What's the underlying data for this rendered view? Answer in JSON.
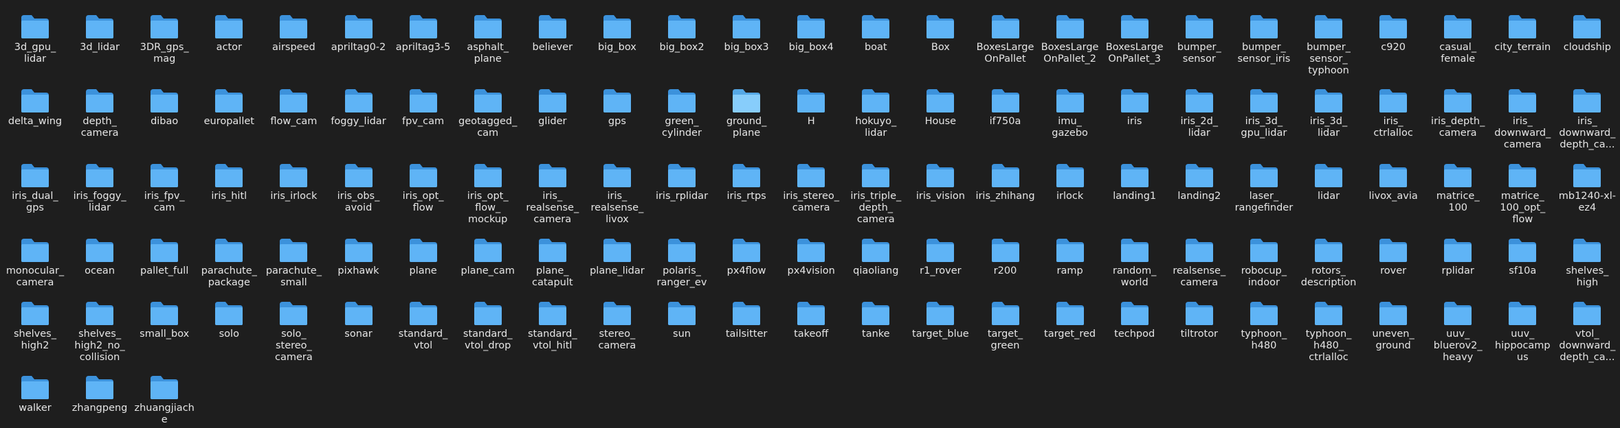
{
  "window": {
    "title": ""
  },
  "colors": {
    "background": "#1e1e1e",
    "folder_back": "#3c92dc",
    "folder_front": "#5fb4f6",
    "folder_back_selected": "#55a8e6",
    "folder_front_selected": "#87cdfb",
    "label": "#e6e6e6"
  },
  "icon_name": "folder-icon",
  "rows": [
    [
      {
        "label": "3d_gpu_\nlidar",
        "name": "3d_gpu_lidar"
      },
      {
        "label": "3d_lidar",
        "name": "3d_lidar"
      },
      {
        "label": "3DR_gps_\nmag",
        "name": "3DR_gps_mag"
      },
      {
        "label": "actor",
        "name": "actor"
      },
      {
        "label": "airspeed",
        "name": "airspeed"
      },
      {
        "label": "apriltag0-2",
        "name": "apriltag0-2"
      },
      {
        "label": "apriltag3-5",
        "name": "apriltag3-5"
      },
      {
        "label": "asphalt_\nplane",
        "name": "asphalt_plane"
      },
      {
        "label": "believer",
        "name": "believer"
      },
      {
        "label": "big_box",
        "name": "big_box"
      },
      {
        "label": "big_box2",
        "name": "big_box2"
      },
      {
        "label": "big_box3",
        "name": "big_box3"
      },
      {
        "label": "big_box4",
        "name": "big_box4"
      },
      {
        "label": "boat",
        "name": "boat"
      },
      {
        "label": "Box",
        "name": "Box"
      },
      {
        "label": "BoxesLarge\nOnPallet",
        "name": "BoxesLargeOnPallet"
      },
      {
        "label": "BoxesLarge\nOnPallet_2",
        "name": "BoxesLargeOnPallet_2"
      },
      {
        "label": "BoxesLarge\nOnPallet_3",
        "name": "BoxesLargeOnPallet_3"
      },
      {
        "label": "bumper_\nsensor",
        "name": "bumper_sensor"
      },
      {
        "label": "bumper_\nsensor_iris",
        "name": "bumper_sensor_iris"
      },
      {
        "label": "bumper_\nsensor_\ntyphoon",
        "name": "bumper_sensor_typhoon"
      },
      {
        "label": "c920",
        "name": "c920"
      },
      {
        "label": "casual_\nfemale",
        "name": "casual_female"
      },
      {
        "label": "city_terrain",
        "name": "city_terrain"
      },
      {
        "label": "cloudship",
        "name": "cloudship"
      }
    ],
    [
      {
        "label": "delta_wing",
        "name": "delta_wing"
      },
      {
        "label": "depth_\ncamera",
        "name": "depth_camera"
      },
      {
        "label": "dibao",
        "name": "dibao"
      },
      {
        "label": "europallet",
        "name": "europallet"
      },
      {
        "label": "flow_cam",
        "name": "flow_cam"
      },
      {
        "label": "foggy_lidar",
        "name": "foggy_lidar"
      },
      {
        "label": "fpv_cam",
        "name": "fpv_cam"
      },
      {
        "label": "geotagged_\ncam",
        "name": "geotagged_cam"
      },
      {
        "label": "glider",
        "name": "glider"
      },
      {
        "label": "gps",
        "name": "gps"
      },
      {
        "label": "green_\ncylinder",
        "name": "green_cylinder"
      },
      {
        "label": "ground_\nplane",
        "name": "ground_plane",
        "selected": true
      },
      {
        "label": "H",
        "name": "H"
      },
      {
        "label": "hokuyo_\nlidar",
        "name": "hokuyo_lidar"
      },
      {
        "label": "House",
        "name": "House"
      },
      {
        "label": "if750a",
        "name": "if750a"
      },
      {
        "label": "imu_\ngazebo",
        "name": "imu_gazebo"
      },
      {
        "label": "iris",
        "name": "iris"
      },
      {
        "label": "iris_2d_\nlidar",
        "name": "iris_2d_lidar"
      },
      {
        "label": "iris_3d_\ngpu_lidar",
        "name": "iris_3d_gpu_lidar"
      },
      {
        "label": "iris_3d_\nlidar",
        "name": "iris_3d_lidar"
      },
      {
        "label": "iris_\nctrlalloc",
        "name": "iris_ctrlalloc"
      },
      {
        "label": "iris_depth_\ncamera",
        "name": "iris_depth_camera"
      },
      {
        "label": "iris_\ndownward_\ncamera",
        "name": "iris_downward_camera"
      },
      {
        "label": "iris_\ndownward_\ndepth_ca...",
        "name": "iris_downward_depth_camera"
      }
    ],
    [
      {
        "label": "iris_dual_\ngps",
        "name": "iris_dual_gps"
      },
      {
        "label": "iris_foggy_\nlidar",
        "name": "iris_foggy_lidar"
      },
      {
        "label": "iris_fpv_\ncam",
        "name": "iris_fpv_cam"
      },
      {
        "label": "iris_hitl",
        "name": "iris_hitl"
      },
      {
        "label": "iris_irlock",
        "name": "iris_irlock"
      },
      {
        "label": "iris_obs_\navoid",
        "name": "iris_obs_avoid"
      },
      {
        "label": "iris_opt_\nflow",
        "name": "iris_opt_flow"
      },
      {
        "label": "iris_opt_\nflow_\nmockup",
        "name": "iris_opt_flow_mockup"
      },
      {
        "label": "iris_\nrealsense_\ncamera",
        "name": "iris_realsense_camera"
      },
      {
        "label": "iris_\nrealsense_\nlivox",
        "name": "iris_realsense_livox"
      },
      {
        "label": "iris_rplidar",
        "name": "iris_rplidar"
      },
      {
        "label": "iris_rtps",
        "name": "iris_rtps"
      },
      {
        "label": "iris_stereo_\ncamera",
        "name": "iris_stereo_camera"
      },
      {
        "label": "iris_triple_\ndepth_\ncamera",
        "name": "iris_triple_depth_camera"
      },
      {
        "label": "iris_vision",
        "name": "iris_vision"
      },
      {
        "label": "iris_zhihang",
        "name": "iris_zhihang"
      },
      {
        "label": "irlock",
        "name": "irlock"
      },
      {
        "label": "landing1",
        "name": "landing1"
      },
      {
        "label": "landing2",
        "name": "landing2"
      },
      {
        "label": "laser_\nrangefinder",
        "name": "laser_rangefinder"
      },
      {
        "label": "lidar",
        "name": "lidar"
      },
      {
        "label": "livox_avia",
        "name": "livox_avia"
      },
      {
        "label": "matrice_\n100",
        "name": "matrice_100"
      },
      {
        "label": "matrice_\n100_opt_\nflow",
        "name": "matrice_100_opt_flow"
      },
      {
        "label": "mb1240-xl-\nez4",
        "name": "mb1240-xl-ez4"
      }
    ],
    [
      {
        "label": "monocular_\ncamera",
        "name": "monocular_camera"
      },
      {
        "label": "ocean",
        "name": "ocean"
      },
      {
        "label": "pallet_full",
        "name": "pallet_full"
      },
      {
        "label": "parachute_\npackage",
        "name": "parachute_package"
      },
      {
        "label": "parachute_\nsmall",
        "name": "parachute_small"
      },
      {
        "label": "pixhawk",
        "name": "pixhawk"
      },
      {
        "label": "plane",
        "name": "plane"
      },
      {
        "label": "plane_cam",
        "name": "plane_cam"
      },
      {
        "label": "plane_\ncatapult",
        "name": "plane_catapult"
      },
      {
        "label": "plane_lidar",
        "name": "plane_lidar"
      },
      {
        "label": "polaris_\nranger_ev",
        "name": "polaris_ranger_ev"
      },
      {
        "label": "px4flow",
        "name": "px4flow"
      },
      {
        "label": "px4vision",
        "name": "px4vision"
      },
      {
        "label": "qiaoliang",
        "name": "qiaoliang"
      },
      {
        "label": "r1_rover",
        "name": "r1_rover"
      },
      {
        "label": "r200",
        "name": "r200"
      },
      {
        "label": "ramp",
        "name": "ramp"
      },
      {
        "label": "random_\nworld",
        "name": "random_world"
      },
      {
        "label": "realsense_\ncamera",
        "name": "realsense_camera"
      },
      {
        "label": "robocup_\nindoor",
        "name": "robocup_indoor"
      },
      {
        "label": "rotors_\ndescription",
        "name": "rotors_description"
      },
      {
        "label": "rover",
        "name": "rover"
      },
      {
        "label": "rplidar",
        "name": "rplidar"
      },
      {
        "label": "sf10a",
        "name": "sf10a"
      },
      {
        "label": "shelves_\nhigh",
        "name": "shelves_high"
      }
    ],
    [
      {
        "label": "shelves_\nhigh2",
        "name": "shelves_high2"
      },
      {
        "label": "shelves_\nhigh2_no_\ncollision",
        "name": "shelves_high2_no_collision"
      },
      {
        "label": "small_box",
        "name": "small_box"
      },
      {
        "label": "solo",
        "name": "solo"
      },
      {
        "label": "solo_\nstereo_\ncamera",
        "name": "solo_stereo_camera"
      },
      {
        "label": "sonar",
        "name": "sonar"
      },
      {
        "label": "standard_\nvtol",
        "name": "standard_vtol"
      },
      {
        "label": "standard_\nvtol_drop",
        "name": "standard_vtol_drop"
      },
      {
        "label": "standard_\nvtol_hitl",
        "name": "standard_vtol_hitl"
      },
      {
        "label": "stereo_\ncamera",
        "name": "stereo_camera"
      },
      {
        "label": "sun",
        "name": "sun"
      },
      {
        "label": "tailsitter",
        "name": "tailsitter"
      },
      {
        "label": "takeoff",
        "name": "takeoff"
      },
      {
        "label": "tanke",
        "name": "tanke"
      },
      {
        "label": "target_blue",
        "name": "target_blue"
      },
      {
        "label": "target_\ngreen",
        "name": "target_green"
      },
      {
        "label": "target_red",
        "name": "target_red"
      },
      {
        "label": "techpod",
        "name": "techpod"
      },
      {
        "label": "tiltrotor",
        "name": "tiltrotor"
      },
      {
        "label": "typhoon_\nh480",
        "name": "typhoon_h480"
      },
      {
        "label": "typhoon_\nh480_\nctrlalloc",
        "name": "typhoon_h480_ctrlalloc"
      },
      {
        "label": "uneven_\nground",
        "name": "uneven_ground"
      },
      {
        "label": "uuv_\nbluerov2_\nheavy",
        "name": "uuv_bluerov2_heavy"
      },
      {
        "label": "uuv_\nhippocamp\nus",
        "name": "uuv_hippocampus"
      },
      {
        "label": "vtol_\ndownward_\ndepth_ca...",
        "name": "vtol_downward_depth_camera"
      }
    ],
    [
      {
        "label": "walker",
        "name": "walker"
      },
      {
        "label": "zhangpeng",
        "name": "zhangpeng"
      },
      {
        "label": "zhuangjiach\ne",
        "name": "zhuangjiache"
      }
    ]
  ]
}
